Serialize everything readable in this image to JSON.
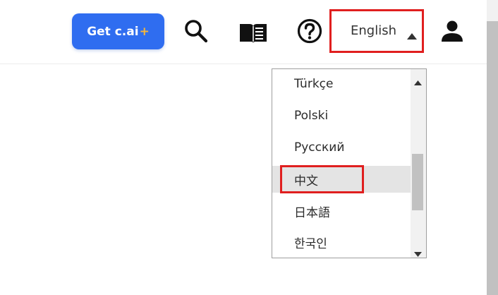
{
  "header": {
    "cta_label": "Get c.ai",
    "cta_plus": "+",
    "search_icon": "search-icon",
    "book_icon": "book-icon",
    "help_icon": "help-icon",
    "language_selected": "English",
    "profile_icon": "user-icon"
  },
  "colors": {
    "accent": "#2f6df0",
    "plus": "#f4b63c",
    "highlight": "#e01f1f"
  },
  "dropdown": {
    "options": [
      {
        "label": "Türkçe"
      },
      {
        "label": "Polski"
      },
      {
        "label": "Русский"
      },
      {
        "label": "中文"
      },
      {
        "label": "日本語"
      },
      {
        "label": "한국인"
      }
    ]
  }
}
